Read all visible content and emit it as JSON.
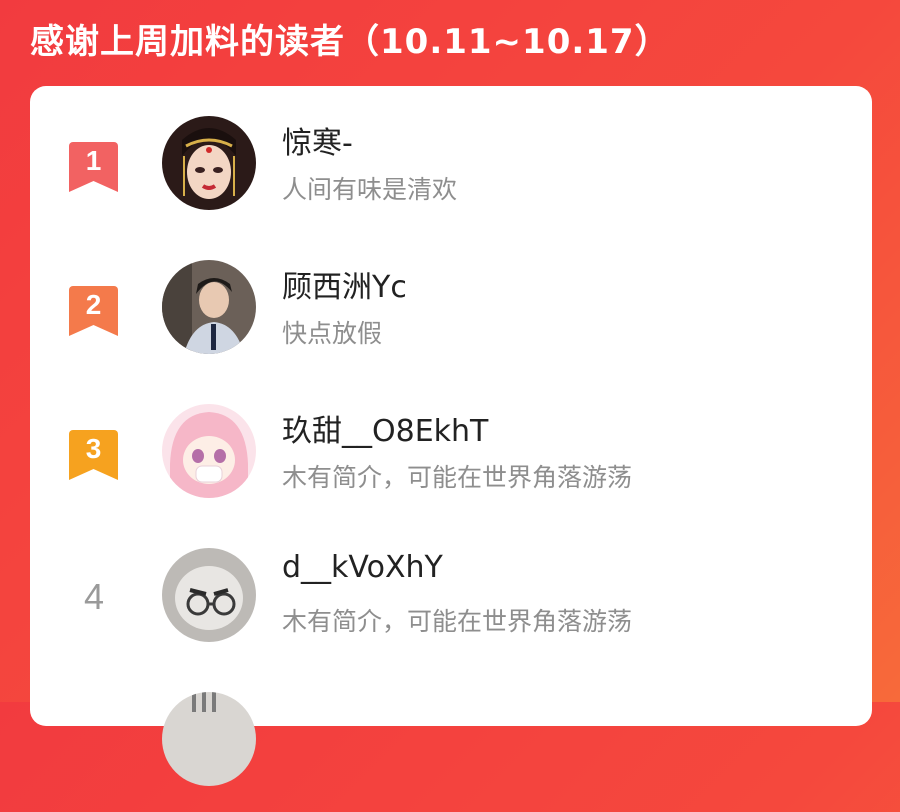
{
  "header": {
    "title": "感谢上周加料的读者（10.11~10.17）"
  },
  "colors": {
    "background_top": "#f23b3f",
    "background_bottom": "#f76a3a",
    "rank1": "#f26262",
    "rank2": "#f47a4b",
    "rank3": "#f6a21f",
    "rank_plain": "#9a9a9a"
  },
  "readers": [
    {
      "rank": "1",
      "name": "惊寒-",
      "bio": "人间有味是清欢"
    },
    {
      "rank": "2",
      "name": "顾西洲Yc",
      "bio": "快点放假"
    },
    {
      "rank": "3",
      "name": "玖甜__O8EkhT",
      "bio": "木有简介，可能在世界角落游荡"
    },
    {
      "rank": "4",
      "name": "d__kVoXhY",
      "bio": "木有简介，可能在世界角落游荡"
    }
  ]
}
